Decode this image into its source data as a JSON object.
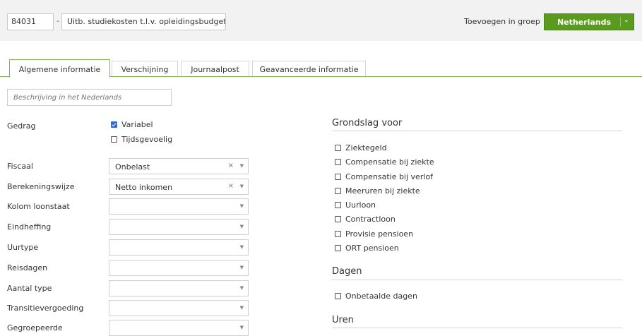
{
  "header": {
    "code": "84031",
    "separator": "-",
    "name": "Uitb. studiekosten t.l.v. opleidingsbudget",
    "group_label": "Toevoegen in groep",
    "group_button": "Netherlands",
    "group_button_icon": "chevron-down-icon"
  },
  "tabs": [
    {
      "label": "Algemene informatie",
      "active": true
    },
    {
      "label": "Verschijning",
      "active": false
    },
    {
      "label": "Journaalpost",
      "active": false
    },
    {
      "label": "Geavanceerde informatie",
      "active": false
    }
  ],
  "description": {
    "placeholder": "Beschrijving in het Nederlands",
    "value": ""
  },
  "gedrag": {
    "label": "Gedrag",
    "options": [
      {
        "label": "Variabel",
        "checked": true
      },
      {
        "label": "Tijdsgevoelig",
        "checked": false
      }
    ]
  },
  "fields": [
    {
      "label": "Fiscaal",
      "value": "Onbelast",
      "clear": "×"
    },
    {
      "label": "Berekeningswijze",
      "value": "Netto inkomen",
      "clear": "×"
    },
    {
      "label": "Kolom loonstaat",
      "value": ""
    },
    {
      "label": "Eindheffing",
      "value": ""
    },
    {
      "label": "Uurtype",
      "value": ""
    },
    {
      "label": "Reisdagen",
      "value": ""
    },
    {
      "label": "Aantal type",
      "value": ""
    },
    {
      "label": "Transitievergoeding",
      "value": ""
    },
    {
      "label": "Gegroepeerde",
      "value": ""
    }
  ],
  "select_arrow": "▼",
  "grondslag": {
    "title": "Grondslag voor",
    "items": [
      {
        "label": "Ziektegeld",
        "checked": false
      },
      {
        "label": "Compensatie bij ziekte",
        "checked": false
      },
      {
        "label": "Compensatie bij verlof",
        "checked": false
      },
      {
        "label": "Meeruren bij ziekte",
        "checked": false
      },
      {
        "label": "Uurloon",
        "checked": false
      },
      {
        "label": "Contractloon",
        "checked": false
      },
      {
        "label": "Provisie pensioen",
        "checked": false
      },
      {
        "label": "ORT pensioen",
        "checked": false
      }
    ]
  },
  "dagen": {
    "title": "Dagen",
    "items": [
      {
        "label": "Onbetaalde dagen",
        "checked": false
      }
    ]
  },
  "uren": {
    "title": "Uren"
  },
  "colors": {
    "accent": "#5a9a1e",
    "tab_border": "#7fb34a",
    "checkbox_checked": "#2f6bd3"
  }
}
